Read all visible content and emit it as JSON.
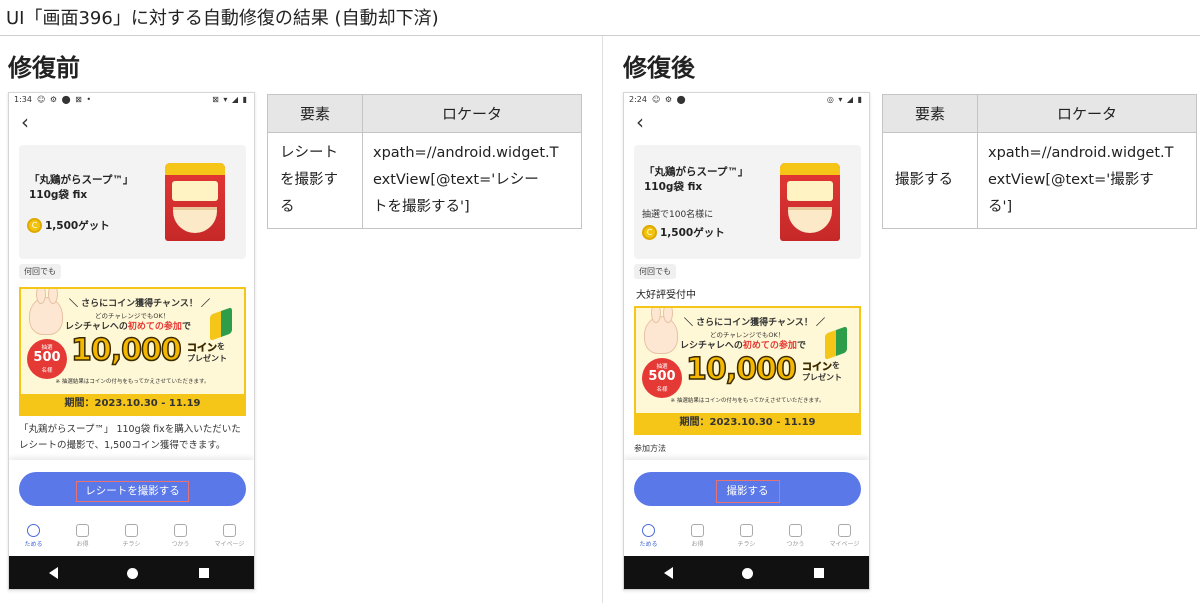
{
  "page_title": "UI「画面396」に対する自動修復の結果 (自動却下済)",
  "before": {
    "heading": "修復前",
    "phone": {
      "status_time": "1:34",
      "status_left_icons": "☺ ⚙ ⬤ ⊠ •",
      "status_right_icons": "⊠ ▾ ◢ ▮",
      "back_icon": "‹",
      "product_name": "「丸鶏がらスープ™」 110g袋 fix",
      "coin_symbol": "C",
      "coin_text": "1,500ゲット",
      "chip": "何回でも",
      "banner": {
        "heading": "＼ さらにコイン獲得チャンス！ ／",
        "sub": "どのチャレンジでもOK！",
        "line_pre": "レシチャレへの",
        "line_highlight": "初めての参加",
        "line_post": "で",
        "prize_top": "抽選",
        "prize_count": "500",
        "prize_unit": "名様",
        "coins": "10,000",
        "coin_word": "コイン",
        "coin_suffix": "を",
        "present": "プレゼント",
        "note": "※ 抽選結果はコインの付与をもってかえさせていただきます。",
        "period": "期間：2023.10.30 - 11.19"
      },
      "description": "「丸鶏がらスープ™」 110g袋 fixを購入いただいたレシートの撮影で、1,500コイン獲得できます。",
      "cta_label": "レシートを撮影する",
      "tabs": [
        {
          "label": "ためる"
        },
        {
          "label": "お得"
        },
        {
          "label": "チラシ"
        },
        {
          "label": "つかう"
        },
        {
          "label": "マイページ"
        }
      ]
    },
    "table": {
      "headers": [
        "要素",
        "ロケータ"
      ],
      "rows": [
        {
          "element_lines": [
            "レシート",
            "を撮影す",
            "る"
          ],
          "locator_lines": [
            "xpath=//android.widget.T",
            "extView[@text='レシー",
            "トを撮影する']"
          ]
        }
      ]
    }
  },
  "after": {
    "heading": "修復後",
    "phone": {
      "status_time": "2:24",
      "status_left_icons": "☺ ⚙ ⬤",
      "status_right_icons": "◎ ▾ ◢ ▮",
      "back_icon": "‹",
      "product_name": "「丸鶏がらスープ™」 110g袋 fix",
      "lottery_note": "抽選で100名様に",
      "coin_symbol": "C",
      "coin_text": "1,500ゲット",
      "chip": "何回でも",
      "accept_text": "大好評受付中",
      "banner": {
        "heading": "＼ さらにコイン獲得チャンス！ ／",
        "sub": "どのチャレンジでもOK！",
        "line_pre": "レシチャレへの",
        "line_highlight": "初めての参加",
        "line_post": "で",
        "prize_top": "抽選",
        "prize_count": "500",
        "prize_unit": "名様",
        "coins": "10,000",
        "coin_word": "コイン",
        "coin_suffix": "を",
        "present": "プレゼント",
        "note": "※ 抽選結果はコインの付与をもってかえさせていただきます。",
        "period": "期間：2023.10.30 - 11.19"
      },
      "method_label": "参加方法",
      "cta_label": "撮影する",
      "tabs": [
        {
          "label": "ためる"
        },
        {
          "label": "お得"
        },
        {
          "label": "チラシ"
        },
        {
          "label": "つかう"
        },
        {
          "label": "マイページ"
        }
      ]
    },
    "table": {
      "headers": [
        "要素",
        "ロケータ"
      ],
      "rows": [
        {
          "element_lines": [
            "撮影する"
          ],
          "locator_lines": [
            "xpath=//android.widget.T",
            "extView[@text='撮影す",
            "る']"
          ]
        }
      ]
    }
  },
  "colors": {
    "cta_blue": "#5b78e8",
    "highlight_border": "#e57373",
    "banner_yellow": "#f5c518",
    "prize_red": "#e53935",
    "active_tab": "#4a6ad8",
    "table_header_bg": "#e6e6e6"
  }
}
